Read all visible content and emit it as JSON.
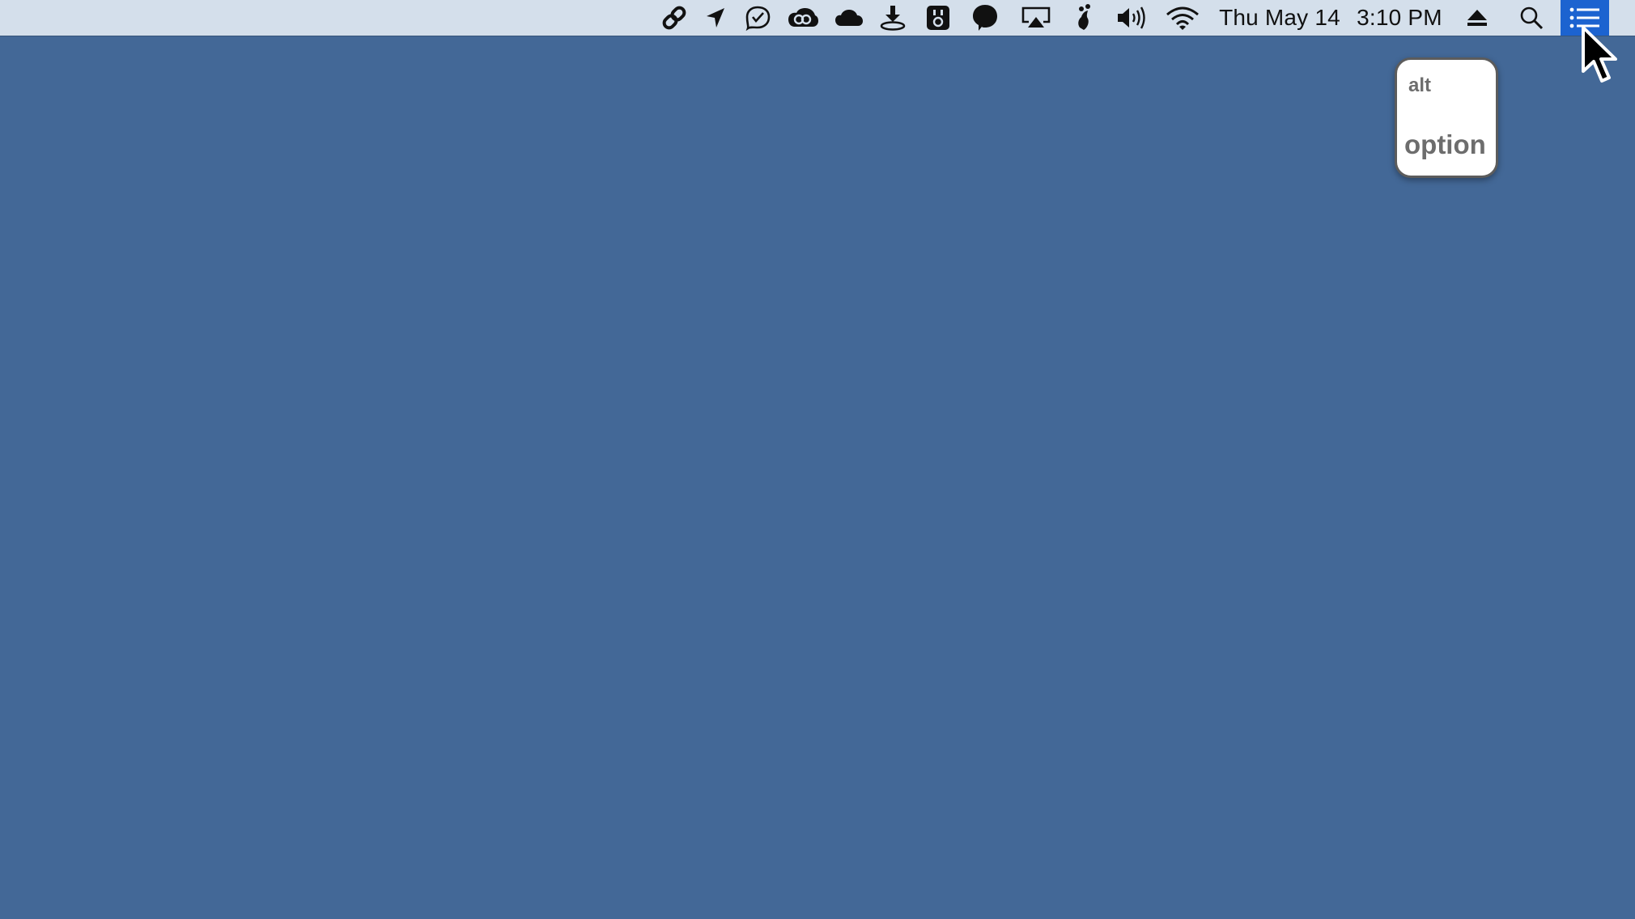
{
  "desktop": {
    "background_color": "#436897"
  },
  "menubar": {
    "background_color": "#d4dfeb",
    "status_icons": [
      "link-icon",
      "location-arrow-icon",
      "checkmark-bubble-icon",
      "creative-cloud-icon",
      "cloud-icon",
      "download-tray-icon",
      "keyboard-viewer-icon",
      "chat-bubble-icon",
      "airplay-icon",
      "paw-icon",
      "volume-icon",
      "wifi-icon"
    ],
    "clock": {
      "date": "Thu May 14",
      "time": "3:10 PM"
    },
    "right_icons": [
      "eject-icon",
      "spotlight-search-icon",
      "notification-center-icon"
    ],
    "active_item_color": "#1c63d0"
  },
  "key_overlay": {
    "top_label": "alt",
    "main_label": "option"
  }
}
